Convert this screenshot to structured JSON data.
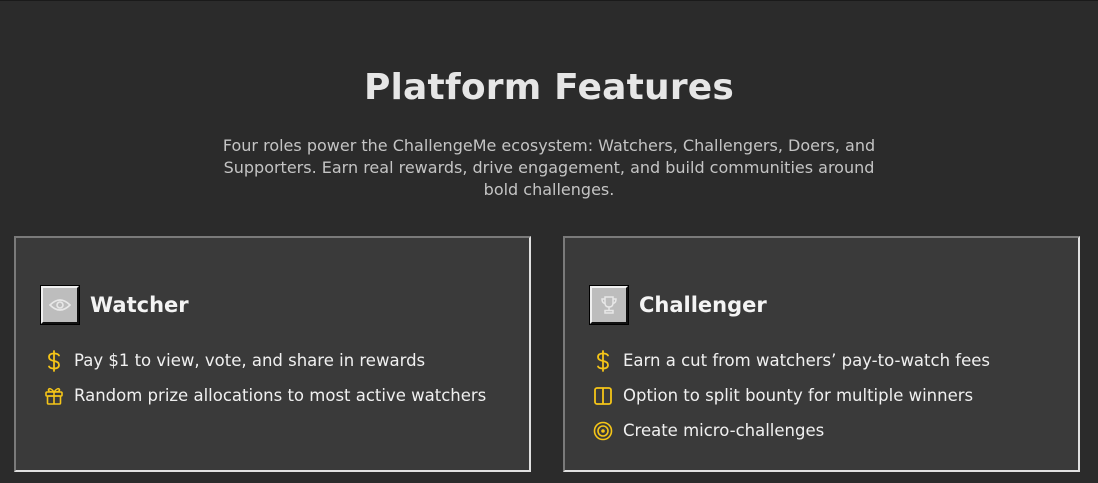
{
  "header": {
    "title": "Platform Features",
    "subtitle": "Four roles power the ChallengeMe ecosystem: Watchers, Challengers, Doers, and Supporters. Earn real rewards, drive engagement, and build communities around bold challenges."
  },
  "colors": {
    "background": "#2b2b2b",
    "card": "#3a3a3a",
    "accent": "#f5c518"
  },
  "cards": [
    {
      "title": "Watcher",
      "icon": "eye-icon",
      "features": [
        {
          "icon": "dollar-icon",
          "text": "Pay $1 to view, vote, and share in rewards"
        },
        {
          "icon": "gift-icon",
          "text": "Random prize allocations to most active watchers"
        }
      ]
    },
    {
      "title": "Challenger",
      "icon": "trophy-icon",
      "features": [
        {
          "icon": "dollar-icon",
          "text": "Earn a cut from watchers’ pay-to-watch fees"
        },
        {
          "icon": "split-icon",
          "text": "Option to split bounty for multiple winners"
        },
        {
          "icon": "target-icon",
          "text": "Create micro-challenges"
        }
      ]
    }
  ]
}
